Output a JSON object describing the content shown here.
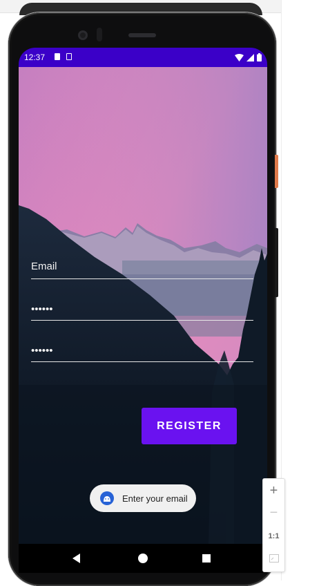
{
  "status_bar": {
    "time": "12:37",
    "color": "#3b00c8"
  },
  "form": {
    "email_label": "Email",
    "password_value": "••••••",
    "confirm_password_value": "••••••",
    "register_label": "REGISTER",
    "register_color": "#6a12f0"
  },
  "toast": {
    "message": "Enter your email",
    "icon": "android-icon"
  },
  "navigation": {
    "back_icon": "back-triangle-icon",
    "home_icon": "home-circle-icon",
    "recents_icon": "recents-square-icon"
  },
  "zoom_controls": {
    "zoom_in": "+",
    "zoom_out": "−",
    "actual_size": "1:1",
    "fit_icon": "fit-screen-icon"
  }
}
